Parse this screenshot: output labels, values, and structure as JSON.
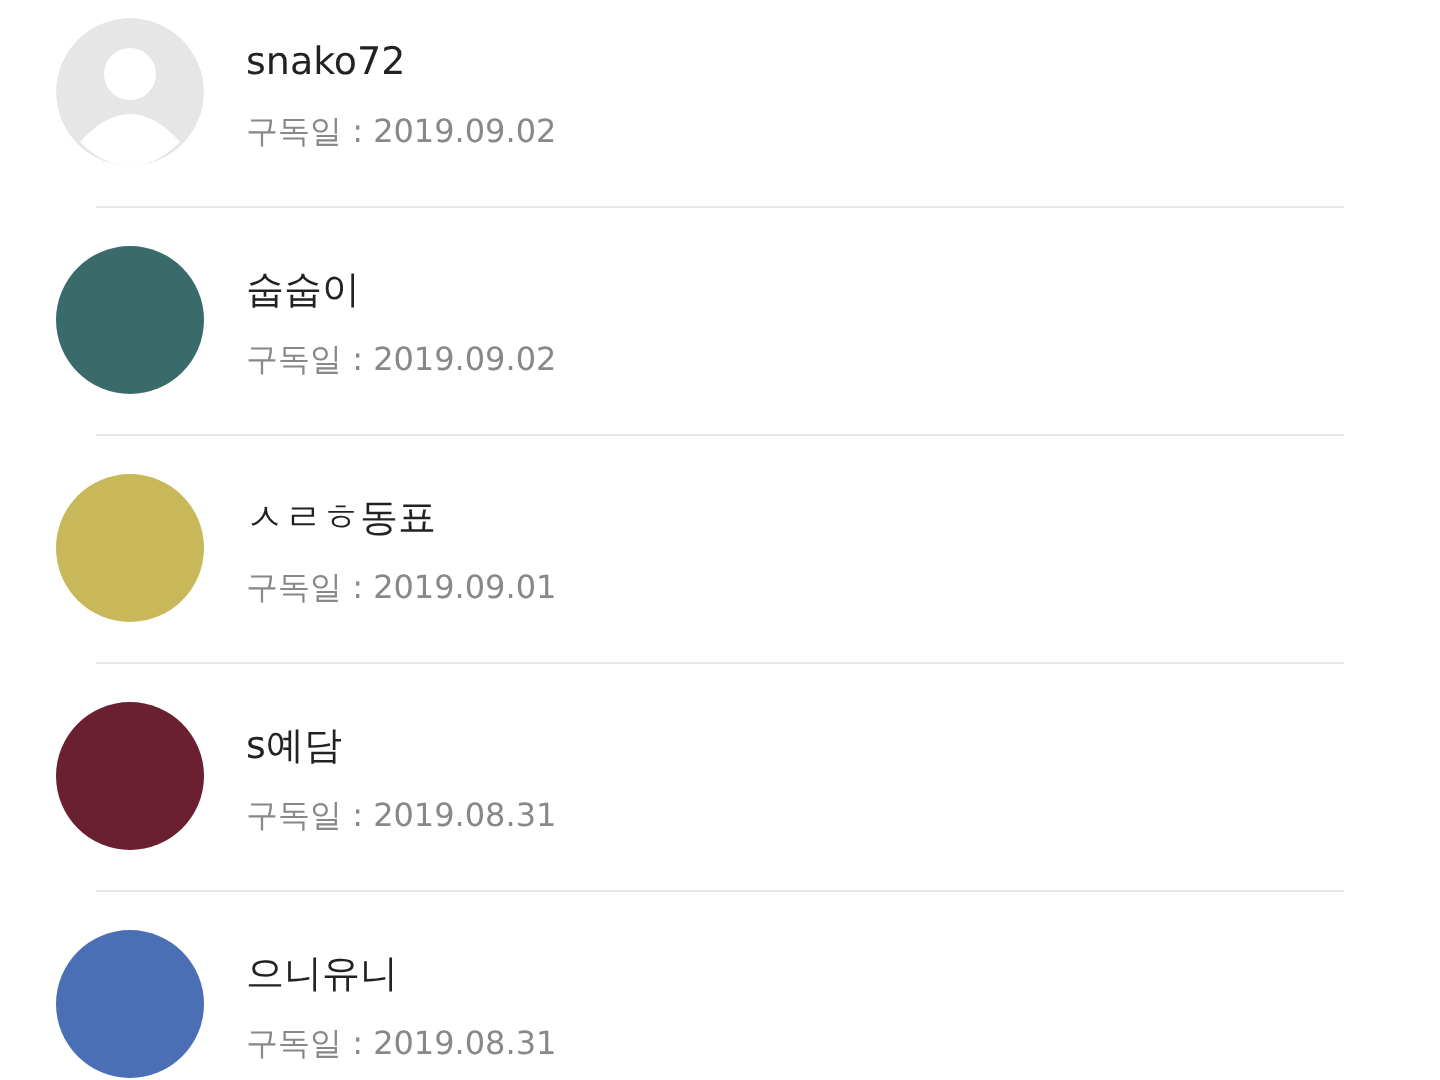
{
  "subscribers": [
    {
      "name": "snako72",
      "date": "구독일 : 2019.09.02",
      "avatar": {
        "kind": "default"
      }
    },
    {
      "name": "숩숩이",
      "date": "구독일 : 2019.09.02",
      "avatar": {
        "kind": "photo"
      }
    },
    {
      "name": "ㅅㄹㅎ동표",
      "date": "구독일 : 2019.09.01",
      "avatar": {
        "kind": "photo"
      }
    },
    {
      "name": "s예담",
      "date": "구독일 : 2019.08.31",
      "avatar": {
        "kind": "photo"
      }
    },
    {
      "name": "으니유니",
      "date": "구독일 : 2019.08.31",
      "avatar": {
        "kind": "photo"
      }
    }
  ]
}
